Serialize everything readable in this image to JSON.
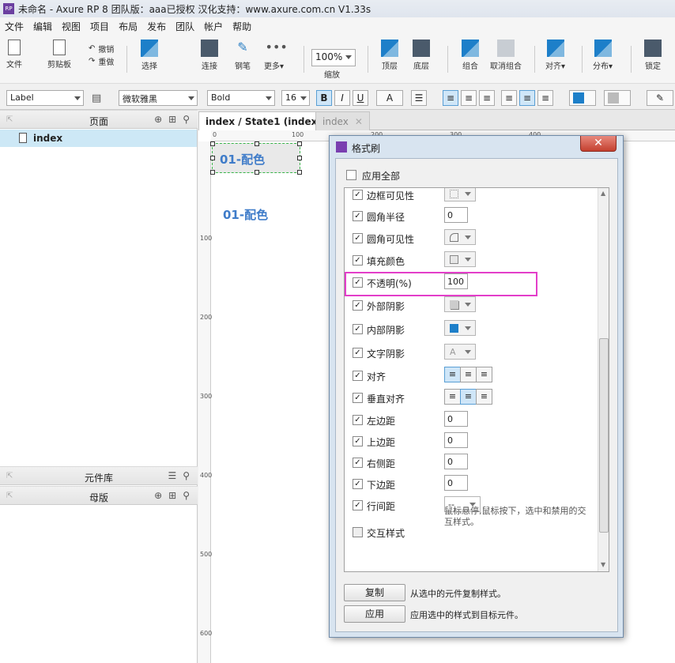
{
  "window": {
    "title": "未命名 - Axure RP 8 团队版：aaa已授权 汉化支持：www.axure.com.cn V1.33s",
    "icon": "rp-logo-icon"
  },
  "menu": [
    "文件",
    "编辑",
    "视图",
    "项目",
    "布局",
    "发布",
    "团队",
    "帐户",
    "帮助"
  ],
  "toolbar": {
    "file": "文件",
    "clipboard": "剪贴板",
    "undo": "撤销",
    "redo": "重做",
    "select": "选择",
    "connect": "连接",
    "pen": "钢笔",
    "more": "更多▾",
    "zoom_value": "100%",
    "zoom_label": "缩放",
    "top": "顶层",
    "bottom": "底层",
    "group": "组合",
    "ungroup": "取消组合",
    "align": "对齐▾",
    "distribute": "分布▾",
    "lock": "锁定"
  },
  "format_bar": {
    "style": "Label",
    "font": "微软雅黑",
    "weight": "Bold",
    "size": "16",
    "bold": "B",
    "italic": "I",
    "underline": "U",
    "font_color": "A"
  },
  "pages_panel": {
    "title": "页面",
    "items": [
      {
        "label": "index"
      }
    ]
  },
  "widgets_panel": {
    "title": "元件库"
  },
  "masters_panel": {
    "title": "母版"
  },
  "tabs": [
    {
      "label": "index / State1 (index)"
    },
    {
      "label": "index"
    }
  ],
  "rulers": {
    "top": [
      "0",
      "100",
      "200",
      "300",
      "400"
    ],
    "left": [
      "100",
      "200",
      "300",
      "400",
      "500",
      "600"
    ]
  },
  "canvas": {
    "selected_widget_text": "01-配色",
    "widget_text": "01-配色"
  },
  "dialog": {
    "title": "格式刷",
    "apply_all": "应用全部",
    "rows": [
      {
        "label": "边框可见性",
        "control": "dropdown",
        "icon": "border-icon"
      },
      {
        "label": "圆角半径",
        "control": "input",
        "value": "0"
      },
      {
        "label": "圆角可见性",
        "control": "dropdown",
        "icon": "corner-icon"
      },
      {
        "label": "填充颜色",
        "control": "dropdown",
        "icon": "fill-color-icon"
      },
      {
        "label": "不透明(%)",
        "control": "input",
        "value": "100"
      },
      {
        "label": "外部阴影",
        "control": "dropdown",
        "icon": "outer-shadow-icon"
      },
      {
        "label": "内部阴影",
        "control": "dropdown",
        "icon": "inner-shadow-icon"
      },
      {
        "label": "文字阴影",
        "control": "dropdown",
        "icon": "text-shadow-icon"
      },
      {
        "label": "对齐",
        "control": "segmented"
      },
      {
        "label": "垂直对齐",
        "control": "segmented"
      },
      {
        "label": "左边距",
        "control": "input",
        "value": "0"
      },
      {
        "label": "上边距",
        "control": "input",
        "value": "0"
      },
      {
        "label": "右侧距",
        "control": "input",
        "value": "0"
      },
      {
        "label": "下边距",
        "control": "input",
        "value": "0"
      },
      {
        "label": "行间距",
        "control": "select",
        "value": "--"
      },
      {
        "label": "交互样式",
        "control": "none"
      }
    ],
    "interaction_note": "鼠标悬停,鼠标按下，选中和禁用的交互样式。",
    "copy_button": "复制",
    "copy_desc": "从选中的元件复制样式。",
    "apply_button": "应用",
    "apply_desc": "应用选中的样式到目标元件。",
    "close_glyph": "✕"
  },
  "colors": {
    "accent_blue": "#3f7cc9",
    "highlight_magenta": "#e33ec9",
    "selection_green": "#39b54a"
  }
}
